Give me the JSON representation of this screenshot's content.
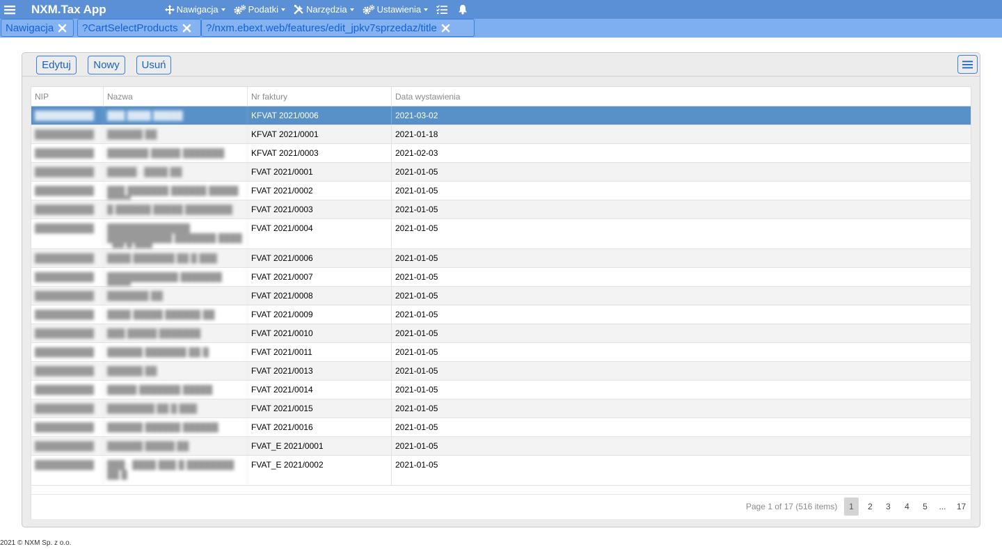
{
  "app": {
    "title": "NXM.Tax App"
  },
  "menu": [
    {
      "label": "Nawigacja",
      "icon": "move-arrows-icon"
    },
    {
      "label": "Podatki",
      "icon": "gears-icon"
    },
    {
      "label": "Narzędzia",
      "icon": "tools-icon"
    },
    {
      "label": "Ustawienia",
      "icon": "gears-icon"
    }
  ],
  "tabs": [
    {
      "label": "Nawigacja"
    },
    {
      "label": "?CartSelectProducts"
    },
    {
      "label": "?/nxm.ebext.web/features/edit_jpkv7sprzedaz/title"
    }
  ],
  "toolbar": {
    "edit": "Edytuj",
    "new": "Nowy",
    "delete": "Usuń"
  },
  "grid": {
    "columns": [
      "NIP",
      "Nazwa",
      "Nr faktury",
      "Data wystawienia"
    ],
    "rows": [
      {
        "nip": "██████████",
        "name": "███ ████ █████",
        "invoice": "KFVAT 2021/0006",
        "date": "2021-03-02"
      },
      {
        "nip": "██████████",
        "name": "██████ ██",
        "invoice": "KFVAT 2021/0001",
        "date": "2021-01-18"
      },
      {
        "nip": "██████████",
        "name": "███████ █████ ███████",
        "invoice": "KFVAT 2021/0003",
        "date": "2021-02-03"
      },
      {
        "nip": "██████████",
        "name": "█████ - ████ ██",
        "invoice": "FVAT 2021/0001",
        "date": "2021-01-05"
      },
      {
        "nip": "██████████",
        "name": "███ ███████ ██████ █████ ████",
        "invoice": "FVAT 2021/0002",
        "date": "2021-01-05"
      },
      {
        "nip": "██████████",
        "name": "█ ██████ █████ ████████",
        "invoice": "FVAT 2021/0003",
        "date": "2021-01-05"
      },
      {
        "nip": "██████████",
        "name": "██████████████ ███████████ ███████ ████ - ██ █ ███",
        "invoice": "FVAT 2021/0004",
        "date": "2021-01-05",
        "tall": true
      },
      {
        "nip": "██████████",
        "name": "████ ███████ ██ █ ███",
        "invoice": "FVAT 2021/0006",
        "date": "2021-01-05"
      },
      {
        "nip": "██████████",
        "name": "████████████ ███████ ████",
        "invoice": "FVAT 2021/0007",
        "date": "2021-01-05"
      },
      {
        "nip": "██████████",
        "name": "███████ ██",
        "invoice": "FVAT 2021/0008",
        "date": "2021-01-05"
      },
      {
        "nip": "██████████",
        "name": "████ █████ ██████ ██",
        "invoice": "FVAT 2021/0009",
        "date": "2021-01-05"
      },
      {
        "nip": "██████████",
        "name": "███ █████ ███████",
        "invoice": "FVAT 2021/0010",
        "date": "2021-01-05"
      },
      {
        "nip": "██████████",
        "name": "██████ ███████ ██ █",
        "invoice": "FVAT 2021/0011",
        "date": "2021-01-05"
      },
      {
        "nip": "██████████",
        "name": "██████ ██",
        "invoice": "FVAT 2021/0013",
        "date": "2021-01-05"
      },
      {
        "nip": "██████████",
        "name": "█████ ███████ █████",
        "invoice": "FVAT 2021/0014",
        "date": "2021-01-05"
      },
      {
        "nip": "██████████",
        "name": "████████ ██ █ ███",
        "invoice": "FVAT 2021/0015",
        "date": "2021-01-05"
      },
      {
        "nip": "██████████",
        "name": "██████ ██████ ██████",
        "invoice": "FVAT 2021/0016",
        "date": "2021-01-05"
      },
      {
        "nip": "██████████",
        "name": "██████ █████ ██",
        "invoice": "FVAT_E 2021/0001",
        "date": "2021-01-05"
      },
      {
        "nip": "██████████",
        "name": "███ - ████ ███ █ ████████ ██ █",
        "invoice": "FVAT_E 2021/0002",
        "date": "2021-01-05",
        "tall": true
      }
    ]
  },
  "pager": {
    "info": "Page 1 of 17 (516 items)",
    "pages": [
      "1",
      "2",
      "3",
      "4",
      "5",
      "...",
      "17"
    ]
  },
  "footer": {
    "text": "2021 © NXM Sp. z o.o."
  },
  "colors": {
    "topbar": "#5b8fd6",
    "tabsbar": "#7eaff0",
    "selected_row": "#5891c7",
    "accent": "#3b7de0"
  }
}
